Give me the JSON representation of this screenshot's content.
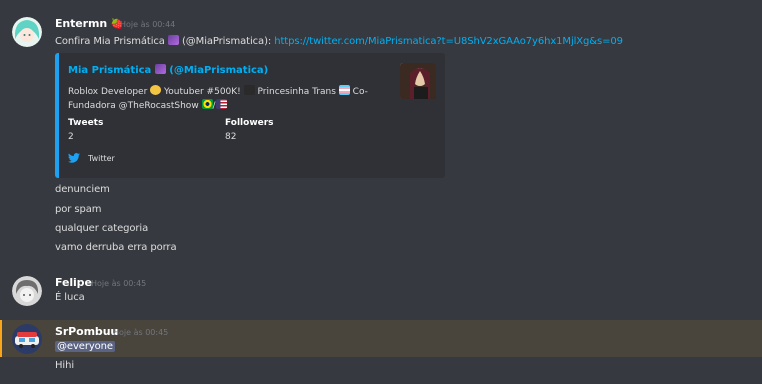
{
  "messages": [
    {
      "username": "Entermn",
      "user_emoji": "🍓",
      "timestamp": "Hoje às 00:44",
      "text_prefix": "Confira Mia Prismática ",
      "text_mid": " (@MiaPrismatica): ",
      "link": "https://twitter.com/MiaPrismatica?t=U8ShV2xGAAo7y6hx1MjlXg&s=09",
      "embed": {
        "author": "Mia Prismática",
        "author_handle": " (@MiaPrismatica)",
        "desc_line1_a": "Roblox Developer ",
        "desc_line1_b": " Youtuber #500K! ",
        "desc_line1_c": " Princesinha Trans ",
        "desc_line1_d": " Co-",
        "desc_line2": "Fundadora @TheRocastShow ",
        "desc_line2_sep": "/",
        "fields": [
          {
            "name": "Tweets",
            "value": "2"
          },
          {
            "name": "Followers",
            "value": "82"
          }
        ],
        "footer": "Twitter"
      },
      "followups": [
        "denunciem",
        "por spam",
        "qualquer categoria",
        "vamo derruba erra porra"
      ]
    },
    {
      "username": "Felipe",
      "timestamp": "Hoje às 00:45",
      "text": "É luca"
    },
    {
      "username": "SrPombuu",
      "timestamp": "Hoje às 00:45",
      "mention": "@everyone",
      "text": "Hihi"
    }
  ],
  "colors": {
    "background": "#36393f",
    "embed_bg": "#2f3136",
    "embed_border": "#1da1f2",
    "link": "#00b0f4",
    "mention_highlight": "#49443c",
    "mention_border": "#faa61a"
  },
  "icons": [
    "strawberry-emoji",
    "sparkles-emoji",
    "twitter-bird-icon",
    "trans-flag-emoji",
    "brazil-flag-emoji",
    "us-flag-emoji"
  ]
}
